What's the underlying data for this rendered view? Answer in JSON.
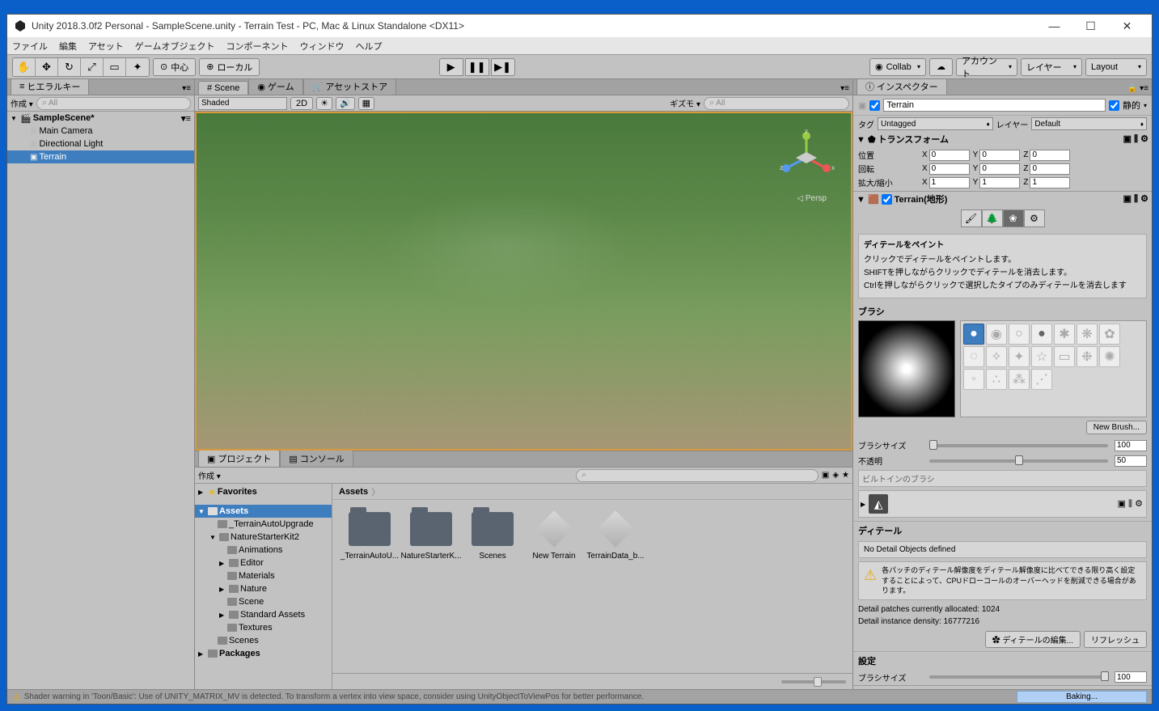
{
  "window": {
    "title": "Unity 2018.3.0f2 Personal - SampleScene.unity - Terrain Test - PC, Mac & Linux Standalone <DX11>"
  },
  "menubar": [
    "ファイル",
    "編集",
    "アセット",
    "ゲームオブジェクト",
    "コンポーネント",
    "ウィンドウ",
    "ヘルプ"
  ],
  "toolbar": {
    "center_label": "中心",
    "local_label": "ローカル",
    "collab": "Collab",
    "account": "アカウント",
    "layers": "レイヤー",
    "layout": "Layout"
  },
  "hierarchy": {
    "panel_label": "ヒエラルキー",
    "create_label": "作成",
    "search_placeholder": "All",
    "root": "SampleScene*",
    "items": [
      "Main Camera",
      "Directional Light",
      "Terrain"
    ]
  },
  "scene": {
    "tab_scene": "Scene",
    "tab_game": "ゲーム",
    "tab_asset_store": "アセットストア",
    "shading": "Shaded",
    "mode_2d": "2D",
    "gizmos": "ギズモ",
    "persp": "Persp",
    "axes": {
      "x": "x",
      "y": "y",
      "z": "z"
    }
  },
  "project": {
    "panel_project": "プロジェクト",
    "panel_console": "コンソール",
    "create_label": "作成",
    "favorites": "Favorites",
    "assets": "Assets",
    "tree": [
      "_TerrainAutoUpgrade",
      "NatureStarterKit2",
      "Animations",
      "Editor",
      "Materials",
      "Nature",
      "Scene",
      "Standard Assets",
      "Textures",
      "Scenes"
    ],
    "packages": "Packages",
    "breadcrumb": "Assets",
    "grid": [
      "_TerrainAutoU...",
      "NatureStarterK...",
      "Scenes",
      "New Terrain",
      "TerrainData_b..."
    ]
  },
  "inspector": {
    "panel_label": "インスペクター",
    "name": "Terrain",
    "static": "静的",
    "tag_label": "タグ",
    "tag_value": "Untagged",
    "layer_label": "レイヤー",
    "layer_value": "Default",
    "transform": {
      "title": "トランスフォーム",
      "position": "位置",
      "rotation": "回転",
      "scale": "拡大/縮小",
      "pos": {
        "x": "0",
        "y": "0",
        "z": "0"
      },
      "rot": {
        "x": "0",
        "y": "0",
        "z": "0"
      },
      "scl": {
        "x": "1",
        "y": "1",
        "z": "1"
      }
    },
    "terrain": {
      "title": "Terrain(地形)",
      "paint_title": "ディテールをペイント",
      "paint_help1": "クリックでディテールをペイントします。",
      "paint_help2": "SHIFTを押しながらクリックでディテールを消去します。",
      "paint_help3": "Ctrlを押しながらクリックで選択したタイプのみディテールを消去します",
      "brush_label": "ブラシ",
      "new_brush": "New Brush...",
      "brush_size_label": "ブラシサイズ",
      "brush_size_value": "100",
      "opacity_label": "不透明",
      "opacity_value": "50",
      "builtin": "ビルトインのブラシ",
      "details_label": "ディテール",
      "no_details": "No Detail Objects defined",
      "warn_text": "各パッチのディテール解像度をディテール解像度に比べてできる限り高く設定することによって、CPUドローコールのオーバーヘッドを削減できる場合があります。",
      "patches": "Detail patches currently allocated: 1024",
      "density": "Detail instance density: 16777216",
      "edit_details": "✿ ディテールの編集...",
      "refresh": "リフレッシュ",
      "settings_label": "設定",
      "brush_size2_label": "ブラシサイズ",
      "brush_size2_value": "100"
    }
  },
  "statusbar": {
    "warning": "Shader warning in 'Toon/Basic': Use of UNITY_MATRIX_MV is detected. To transform a vertex into view space, consider using UnityObjectToViewPos for better performance.",
    "baking": "Baking..."
  }
}
